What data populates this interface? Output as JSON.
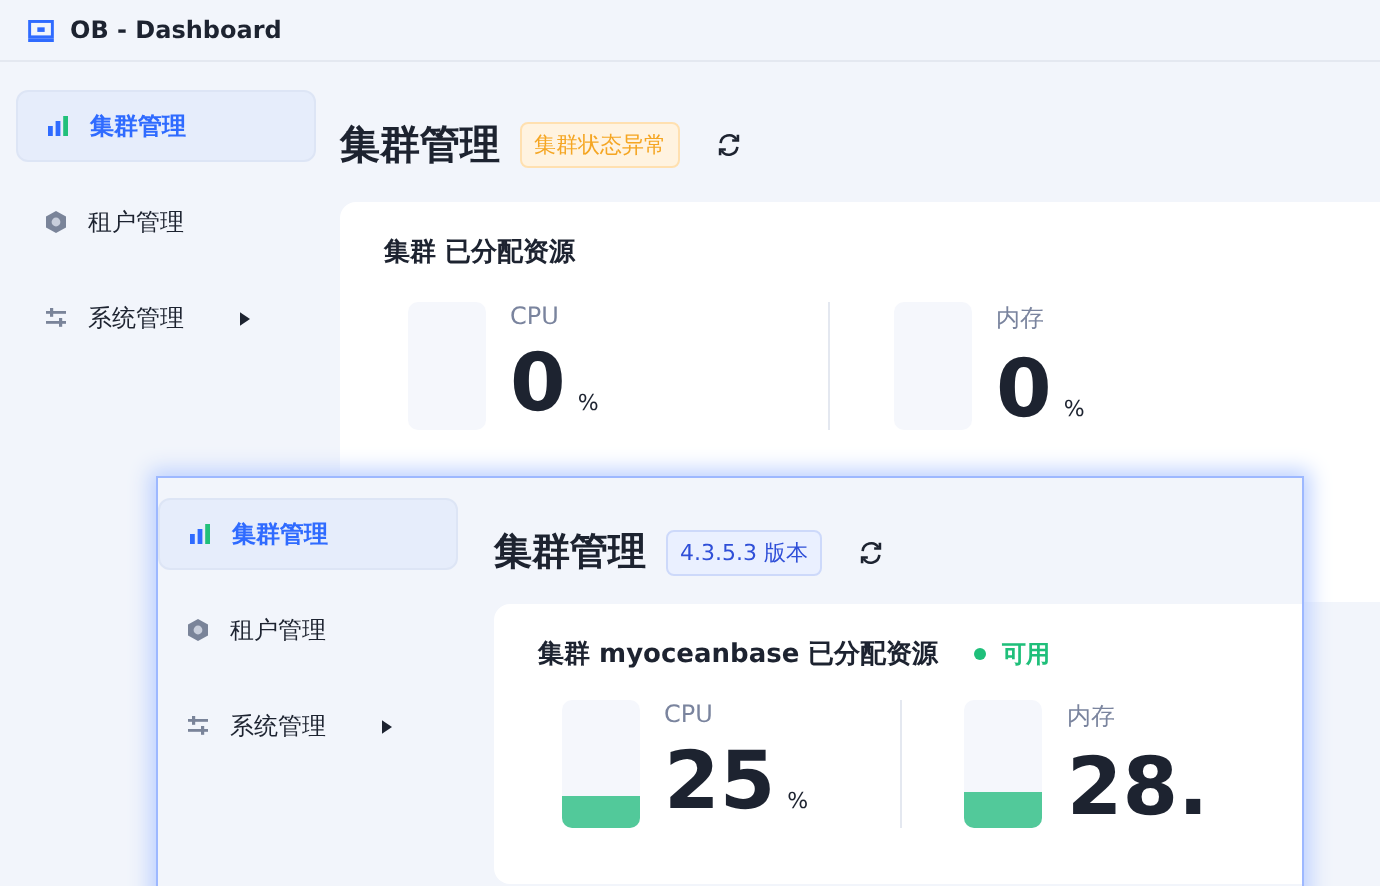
{
  "header": {
    "title": "OB - Dashboard"
  },
  "back": {
    "sidebar": [
      {
        "label": "集群管理",
        "kind": "bars",
        "selected": true,
        "submenu": false
      },
      {
        "label": "租户管理",
        "kind": "hexagon",
        "selected": false,
        "submenu": false
      },
      {
        "label": "系统管理",
        "kind": "sliders",
        "selected": false,
        "submenu": true
      }
    ],
    "title": "集群管理",
    "badge": {
      "text": "集群状态异常",
      "kind": "warning"
    },
    "card": {
      "title": "集群 已分配资源",
      "metrics": [
        {
          "label": "CPU",
          "value": "0",
          "unit": "%",
          "level": 0
        },
        {
          "label": "内存",
          "value": "0",
          "unit": "%",
          "level": 0
        }
      ]
    }
  },
  "front": {
    "sidebar": [
      {
        "label": "集群管理",
        "kind": "bars",
        "selected": true,
        "submenu": false
      },
      {
        "label": "租户管理",
        "kind": "hexagon",
        "selected": false,
        "submenu": false
      },
      {
        "label": "系统管理",
        "kind": "sliders",
        "selected": false,
        "submenu": true
      }
    ],
    "title": "集群管理",
    "badge": {
      "text": "4.3.5.3 版本",
      "kind": "info"
    },
    "card": {
      "title": "集群 myoceanbase 已分配资源",
      "status": {
        "text": "可用",
        "color": "#1fbf7a"
      },
      "metrics": [
        {
          "label": "CPU",
          "value": "25",
          "unit": "%",
          "level": 0.25
        },
        {
          "label": "内存",
          "value": "28.",
          "level": 0.28
        }
      ]
    }
  }
}
